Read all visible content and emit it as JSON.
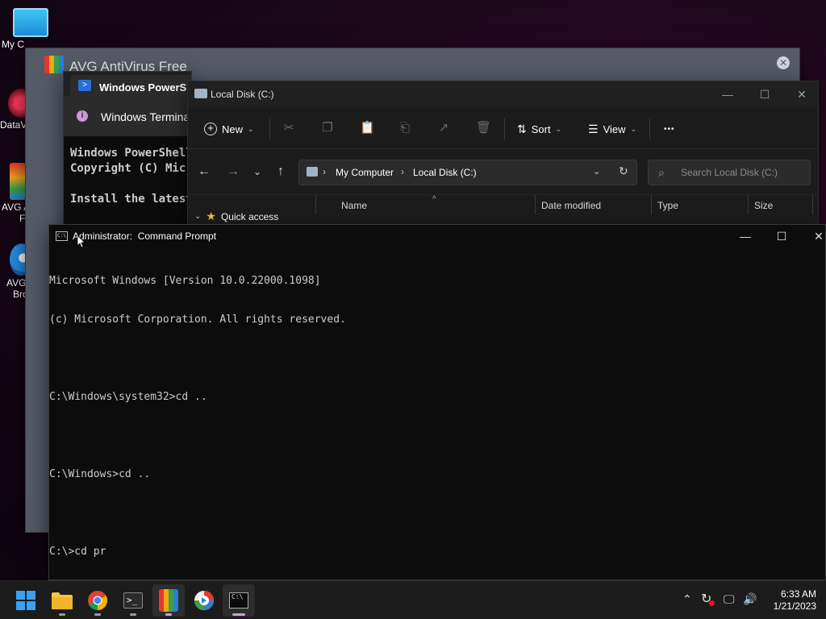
{
  "desktop": {
    "icons": [
      {
        "label": "My C"
      },
      {
        "label": "DataV"
      },
      {
        "label": "AVG A",
        "label2": "F"
      },
      {
        "label": "AVG",
        "label2": "Bro"
      }
    ]
  },
  "avg_window": {
    "title": "AVG AntiVirus Free"
  },
  "terminal": {
    "tab_title": "Windows PowerShell",
    "row_title": "Windows Terminal",
    "body": "Windows PowerShell\nCopyright (C) Microsoft Corporation.\n\nInstall the latest PowerShell"
  },
  "explorer": {
    "title": "Local Disk (C:)",
    "toolbar": {
      "new": "New",
      "sort": "Sort",
      "view": "View",
      "more": "•••"
    },
    "breadcrumb": [
      "My Computer",
      "Local Disk (C:)"
    ],
    "search_placeholder": "Search Local Disk (C:)",
    "columns": [
      "Name",
      "Date modified",
      "Type",
      "Size"
    ],
    "nav_item": "Quick access"
  },
  "cmd": {
    "title": "Administrator:  Command Prompt",
    "lines": [
      "Microsoft Windows [Version 10.0.22000.1098]",
      "(c) Microsoft Corporation. All rights reserved.",
      "",
      "C:\\Windows\\system32>cd ..",
      "",
      "C:\\Windows>cd ..",
      "",
      "C:\\>cd pr"
    ]
  },
  "taskbar": {
    "apps": [
      "start-icon",
      "file-explorer-icon",
      "chrome-icon",
      "terminal-icon",
      "avg-icon",
      "avg-browser-icon",
      "command-prompt-icon"
    ],
    "time": "6:33 AM",
    "date": "1/21/2023"
  }
}
